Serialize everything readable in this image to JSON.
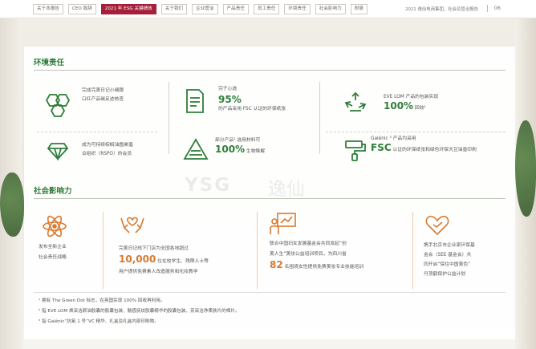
{
  "nav": {
    "tabs": [
      "关于本报告",
      "CEO 致辞",
      "2021 年 ESG 关键绩效",
      "关于我们",
      "企业管治",
      "产品责任",
      "员工责任",
      "环境责任",
      "社会影响力",
      "附录"
    ],
    "active_index": 2,
    "doc_title": "2021 逸仙电商集团，社会及管治报告",
    "page": "06"
  },
  "env": {
    "title": "环境责任",
    "items": [
      {
        "lines": [
          "完成完美日记小细跟",
          "口红产品碳足迹核查"
        ]
      },
      {
        "lines": [
          "完子心选"
        ],
        "big": "95%",
        "after": "的产品采用 FSC 认证的环保纸张"
      },
      {
        "lines": [
          "EVE LOM 产品的包装实现"
        ],
        "big": "100%",
        "after": "回收¹"
      },
      {
        "lines": [
          "成为可持续棕榈油圆桌倡",
          "议组织（RSPO）的会员"
        ]
      },
      {
        "lines": [
          "部分产品² 选用材料可"
        ],
        "big": "100%",
        "after": "生物降解"
      },
      {
        "lines": [
          "Galénic ³ 产品均采用"
        ],
        "big": "FSC",
        "after": "认证的环保纸张和绿色环保大豆油墨印刷"
      }
    ]
  },
  "social": {
    "title": "社会影响力",
    "items": [
      {
        "lines": [
          "发布全新企业",
          "社会责任战略"
        ]
      },
      {
        "line1": "完美日记线下门店为全国各地超过",
        "big": "10,000",
        "after": "位在校学生、残障人士等",
        "line3": "用户提供免费素人改造服务和化妆教学"
      },
      {
        "line1": "联合中国妇女发展基金会共同发起“创",
        "line2": "美人生”美妆公益培训项目，为四川省",
        "big": "82",
        "after": "名困境女性提供免费美妆专业技能培训"
      },
      {
        "lines": [
          "携手北京市企业家环保基",
          "金会（SEE 基金会）共",
          "同开启“保住中国美色”",
          "丹顶鹤保护公益计划"
        ]
      }
    ]
  },
  "footnotes": [
    "¹ 拥有 The Green Dot 标志，在英国实现 100% 回收再利用。",
    "² 指 EVE LOM 焕采洁颜油胶囊的胶囊包装、觥感抚纹胶囊精华的胶囊包装、亮采洁净柔肤片的棉片。",
    "³ 指 Galénic“抗氧 1 号”VC 精华、礼盒及礼盒内部印刷物。"
  ],
  "watermark": {
    "latin": "YSG",
    "cn": "逸仙"
  },
  "colors": {
    "green": "#2f7d3b",
    "orange": "#d8792e",
    "accent": "#a61f3a"
  }
}
